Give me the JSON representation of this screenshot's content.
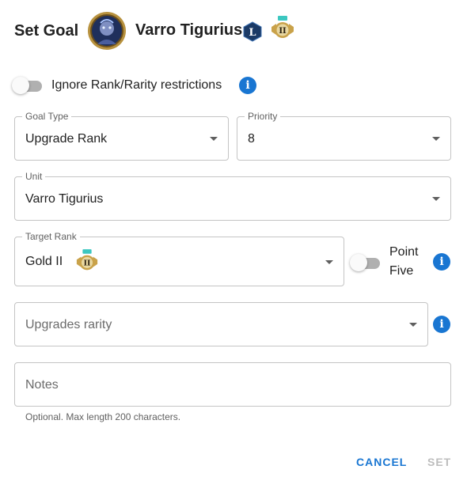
{
  "dialog": {
    "title": "Set Goal",
    "unit_name": "Varro Tigurius",
    "badge_letter": "L",
    "rank_numeral": "II"
  },
  "ignore_restrictions": {
    "label": "Ignore Rank/Rarity restrictions",
    "enabled": false
  },
  "goal_type": {
    "label": "Goal Type",
    "value": "Upgrade Rank"
  },
  "priority": {
    "label": "Priority",
    "value": "8"
  },
  "unit": {
    "label": "Unit",
    "value": "Varro Tigurius"
  },
  "target_rank": {
    "label": "Target Rank",
    "value": "Gold II",
    "rank_numeral": "II"
  },
  "point_five": {
    "label_line1": "Point",
    "label_line2": "Five",
    "enabled": false
  },
  "upgrades_rarity": {
    "placeholder": "Upgrades rarity"
  },
  "notes": {
    "placeholder": "Notes",
    "helper": "Optional. Max length 200 characters."
  },
  "actions": {
    "cancel_label": "CANCEL",
    "set_label": "SET"
  },
  "colors": {
    "accent": "#1976d2",
    "gold": "#c9a24a",
    "disabled": "#bdbdbd"
  }
}
